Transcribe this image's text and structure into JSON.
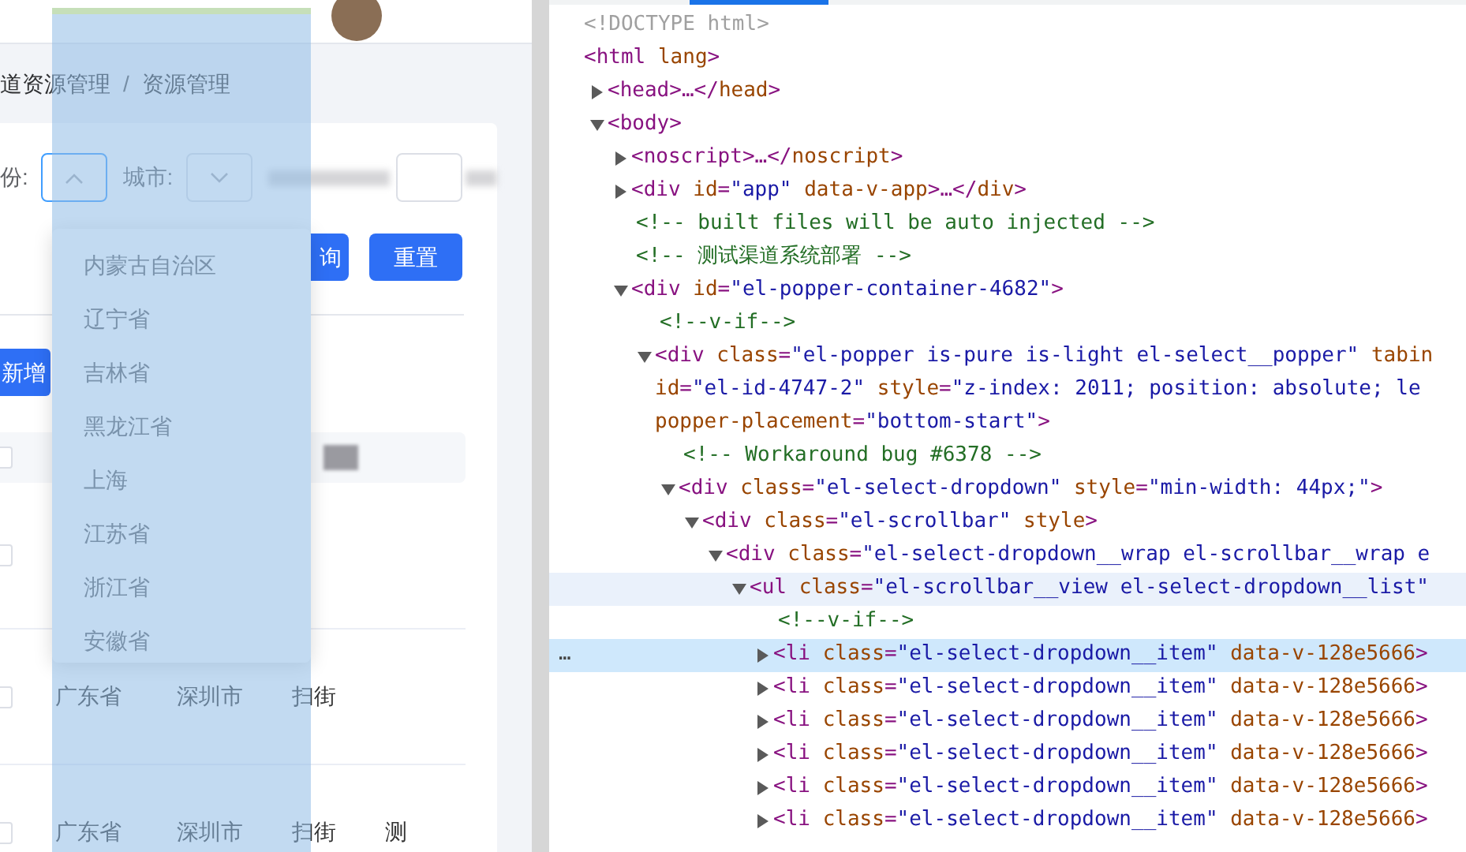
{
  "app": {
    "breadcrumb": [
      "道资源管理",
      "资源管理"
    ],
    "breadcrumb_separator": "/",
    "filters": [
      {
        "kind": "select",
        "label": "份:",
        "expanded": true
      },
      {
        "kind": "select",
        "label": "城市:",
        "expanded": false
      },
      {
        "kind": "input"
      }
    ],
    "buttons": [
      "询",
      "重置"
    ],
    "add_button": "新增",
    "dropdown": {
      "items": [
        {
          "label": "内蒙古自治区",
          "selected": false
        },
        {
          "label": "辽宁省",
          "selected": false
        },
        {
          "label": "吉林省",
          "selected": false
        },
        {
          "label": "黑龙江省",
          "selected": false
        },
        {
          "label": "上海",
          "selected": false
        },
        {
          "label": "江苏省",
          "selected": false
        },
        {
          "label": "浙江省",
          "selected": false
        },
        {
          "label": "安徽省",
          "selected": false
        }
      ]
    },
    "table": {
      "rows": [
        {
          "checked": false
        },
        {
          "checked": false
        },
        {
          "checked": false,
          "cells": [
            "广东省",
            "深圳市",
            "扫街"
          ]
        },
        {
          "checked": false,
          "cells": [
            "广东省",
            "深圳市",
            "扫街",
            "测"
          ]
        }
      ]
    }
  },
  "devtools": {
    "tree": [
      {
        "kind": "doctype",
        "text": "<!DOCTYPE html>",
        "selected": false
      },
      {
        "kind": "element",
        "text": "<html lang>",
        "selected": false,
        "children": [
          {
            "kind": "element",
            "text": "<head>…</head>",
            "expanded": false,
            "selected": false
          },
          {
            "kind": "element",
            "text": "<body>",
            "expanded": true,
            "selected": false,
            "children": [
              {
                "kind": "element",
                "text": "<noscript>…</noscript>",
                "expanded": false,
                "selected": false
              },
              {
                "kind": "element",
                "text": "<div id=\"app\" data-v-app>…</div>",
                "expanded": false,
                "selected": false
              },
              {
                "kind": "comment",
                "text": "<!-- built files will be auto injected -->",
                "selected": false
              },
              {
                "kind": "comment",
                "text": "<!-- 测试渠道系统部署 -->",
                "selected": false
              },
              {
                "kind": "element",
                "text": "<div id=\"el-popper-container-4682\">",
                "expanded": true,
                "selected": false,
                "children": [
                  {
                    "kind": "comment",
                    "text": "<!--v-if-->",
                    "selected": false
                  },
                  {
                    "kind": "element",
                    "text": "<div class=\"el-popper is-pure is-light el-select__popper\" tabin",
                    "more": [
                      "id=\"el-id-4747-2\" style=\"z-index: 2011; position: absolute; le",
                      "popper-placement=\"bottom-start\">"
                    ],
                    "expanded": true,
                    "selected": false,
                    "children": [
                      {
                        "kind": "comment",
                        "text": "<!-- Workaround bug #6378 -->",
                        "selected": false
                      },
                      {
                        "kind": "element",
                        "text": "<div class=\"el-select-dropdown\" style=\"min-width: 44px;\">",
                        "expanded": true,
                        "selected": false,
                        "children": [
                          {
                            "kind": "element",
                            "text": "<div class=\"el-scrollbar\" style>",
                            "expanded": true,
                            "selected": false,
                            "children": [
                              {
                                "kind": "element",
                                "text": "<div class=\"el-select-dropdown__wrap el-scrollbar__wrap e",
                                "expanded": true,
                                "selected": false,
                                "children": [
                                  {
                                    "kind": "element",
                                    "text": "<ul class=\"el-scrollbar__view el-select-dropdown__list\"",
                                    "expanded": true,
                                    "selected": false,
                                    "hovered": true,
                                    "children": [
                                      {
                                        "kind": "comment",
                                        "text": "<!--v-if-->",
                                        "selected": false
                                      },
                                      {
                                        "kind": "element",
                                        "text": "<li class=\"el-select-dropdown__item\" data-v-128e5666>",
                                        "expanded": false,
                                        "selected": true,
                                        "ellipsis": "…"
                                      },
                                      {
                                        "kind": "element",
                                        "text": "<li class=\"el-select-dropdown__item\" data-v-128e5666>",
                                        "expanded": false,
                                        "selected": false
                                      },
                                      {
                                        "kind": "element",
                                        "text": "<li class=\"el-select-dropdown__item\" data-v-128e5666>",
                                        "expanded": false,
                                        "selected": false
                                      },
                                      {
                                        "kind": "element",
                                        "text": "<li class=\"el-select-dropdown__item\" data-v-128e5666>",
                                        "expanded": false,
                                        "selected": false
                                      },
                                      {
                                        "kind": "element",
                                        "text": "<li class=\"el-select-dropdown__item\" data-v-128e5666>",
                                        "expanded": false,
                                        "selected": false
                                      },
                                      {
                                        "kind": "element",
                                        "text": "<li class=\"el-select-dropdown__item\" data-v-128e5666>",
                                        "expanded": false,
                                        "selected": false
                                      }
                                    ]
                                  }
                                ]
                              }
                            ]
                          }
                        ]
                      }
                    ]
                  }
                ]
              }
            ]
          }
        ]
      }
    ]
  }
}
